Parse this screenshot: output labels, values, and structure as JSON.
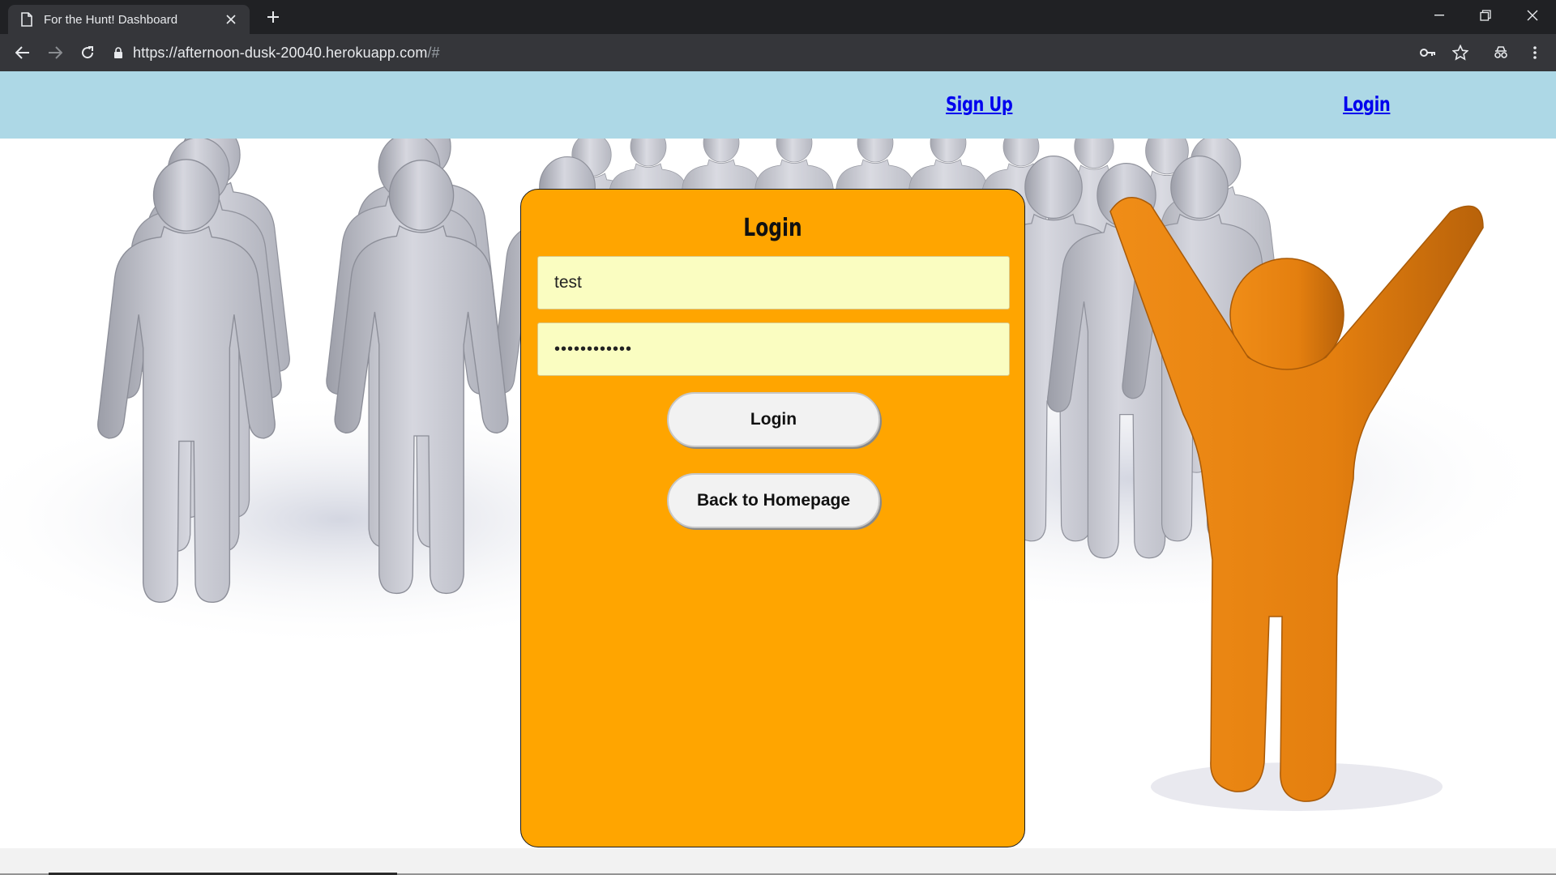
{
  "browser": {
    "tab_title": "For the Hunt! Dashboard",
    "url_main": "https://afternoon-dusk-20040.herokuapp.com",
    "url_suffix": "/#"
  },
  "nav": {
    "signup_label": "Sign Up",
    "login_label": "Login",
    "background_color": "#add8e6",
    "link_color": "#0000ee"
  },
  "login_card": {
    "title": "Login",
    "username_value": "test",
    "password_value": "••••••••••••",
    "login_button": "Login",
    "back_button": "Back to Homepage",
    "background_color": "#ffa500",
    "field_color": "#fafdc1"
  },
  "icons": {
    "page": "document-icon",
    "close": "close-icon",
    "new_tab": "plus-icon",
    "back": "arrow-left-icon",
    "forward": "arrow-right-icon",
    "reload": "reload-icon",
    "lock": "lock-icon",
    "key": "key-icon",
    "star": "star-icon",
    "incognito": "incognito-icon",
    "menu": "kebab-menu-icon"
  }
}
